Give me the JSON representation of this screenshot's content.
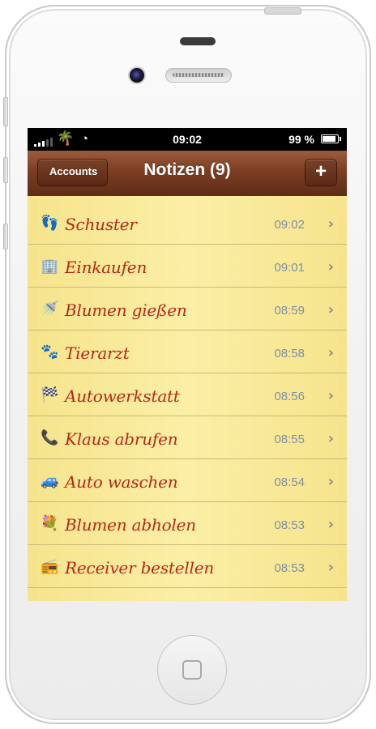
{
  "status_bar": {
    "carrier_icon": "palm-tree-icon",
    "carrier_glyph": "🌴",
    "wifi_glyph": "◔",
    "time": "09:02",
    "battery_percent": "99 %",
    "battery_level": 0.99
  },
  "navbar": {
    "back_label": "Accounts",
    "title": "Notizen (9)",
    "add_label": "+"
  },
  "notes": [
    {
      "icon": "footprints-icon",
      "glyph": "👣",
      "title": "Schuster",
      "time": "09:02"
    },
    {
      "icon": "building-icon",
      "glyph": "🏢",
      "title": "Einkaufen",
      "time": "09:01"
    },
    {
      "icon": "watering-can-icon",
      "glyph": "🚿",
      "title": "Blumen gießen",
      "time": "08:59"
    },
    {
      "icon": "paw-prints-icon",
      "glyph": "🐾",
      "title": "Tierarzt",
      "time": "08:58"
    },
    {
      "icon": "checkered-flag-icon",
      "glyph": "🏁",
      "title": "Autowerkstatt",
      "time": "08:56"
    },
    {
      "icon": "phone-icon",
      "glyph": "📞",
      "title": "Klaus abrufen",
      "time": "08:55"
    },
    {
      "icon": "car-icon",
      "glyph": "🚙",
      "title": "Auto waschen",
      "time": "08:54"
    },
    {
      "icon": "bouquet-icon",
      "glyph": "💐",
      "title": "Blumen abholen",
      "time": "08:53"
    },
    {
      "icon": "radio-icon",
      "glyph": "📻",
      "title": "Receiver bestellen",
      "time": "08:53"
    }
  ],
  "chevron": "›",
  "colors": {
    "navbar": "#7b3e23",
    "paper": "#fbefa6",
    "note_title": "#b4281a",
    "note_time": "#7d8fa7"
  }
}
